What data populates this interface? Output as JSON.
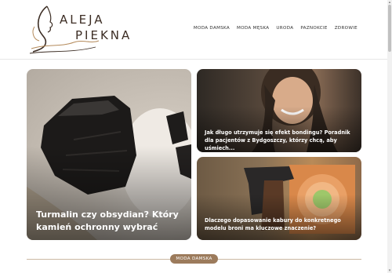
{
  "logo": {
    "line1": "ALEJA",
    "line2": "PIEKNA"
  },
  "nav": {
    "items": [
      "MODA DAMSKA",
      "MODA MĘSKA",
      "URODA",
      "PAZNOKCIE",
      "ZDROWIE"
    ]
  },
  "articles": [
    {
      "title": "Turmalin czy obsydian? Który kamień ochronny wybrać"
    },
    {
      "title": "Jak długo utrzymuje się efekt bondingu? Poradnik dla pacjentów z Bydgoszczy, którzy chcą, aby uśmiech..."
    },
    {
      "title": "Dlaczego dopasowanie kabury do konkretnego modelu broni ma kluczowe znaczenie?"
    }
  ],
  "section": {
    "badge": "MODA DAMSKA"
  }
}
